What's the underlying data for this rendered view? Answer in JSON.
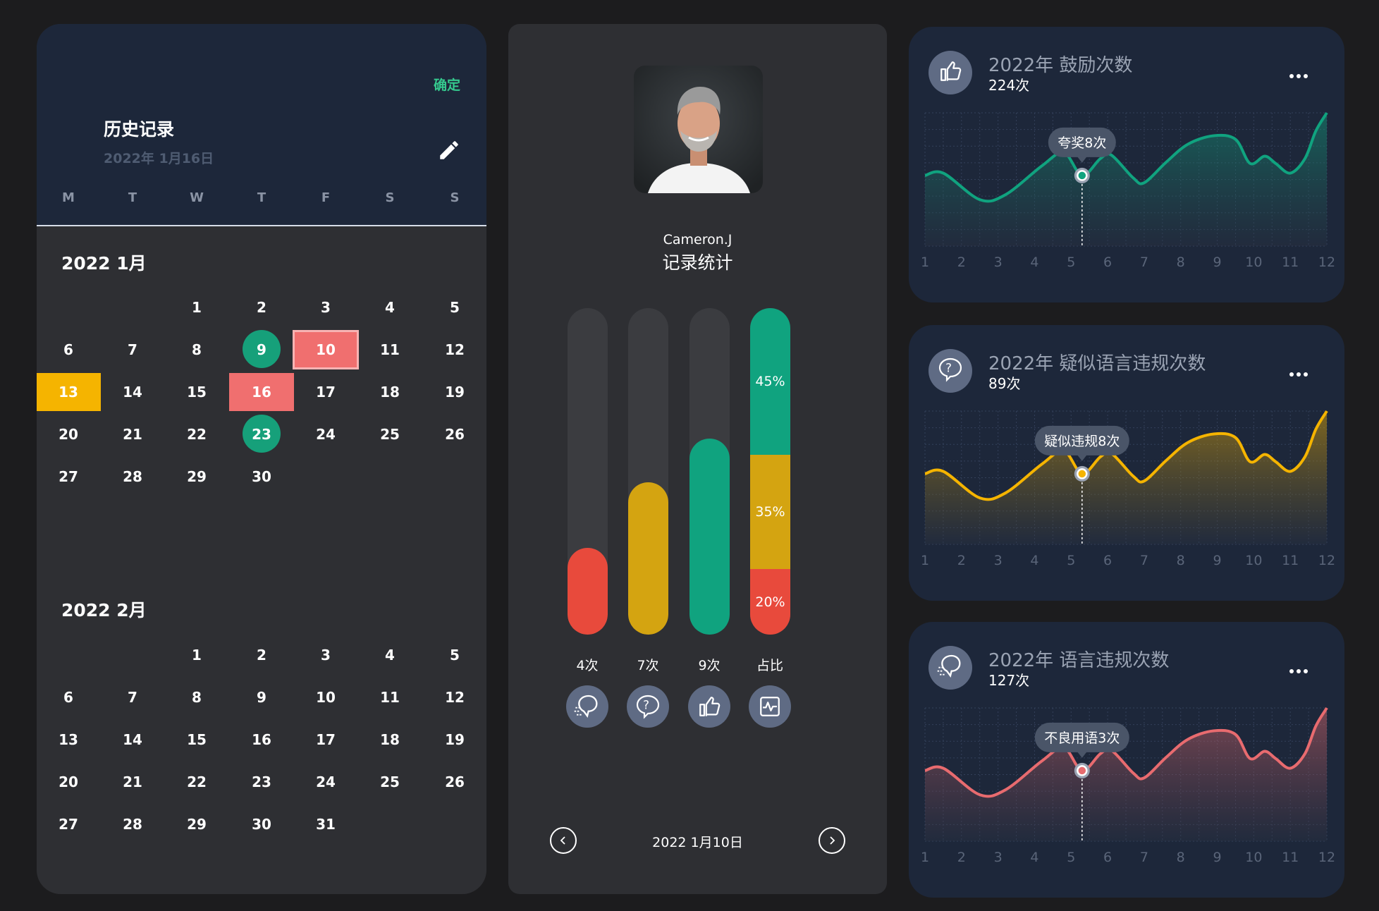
{
  "calendar": {
    "confirm": "确定",
    "title": "历史记录",
    "selected_date": "2022年 1月16日",
    "weekdays": [
      "M",
      "T",
      "W",
      "T",
      "F",
      "S",
      "S"
    ],
    "months": [
      {
        "label": "2022 1月",
        "start_col": 2,
        "days": 30,
        "marked": {
          "9": "circle",
          "23": "circle",
          "10": "red-outline",
          "16": "red",
          "13": "yellow"
        }
      },
      {
        "label": "2022 2月",
        "start_col": 2,
        "days": 31,
        "marked": {}
      }
    ]
  },
  "stats": {
    "user_name": "Cameron.J",
    "title": "记录统计",
    "bars": [
      {
        "label": "4次",
        "value": 4,
        "color": "#e84a3c",
        "icon": "speech-icon"
      },
      {
        "label": "7次",
        "value": 7,
        "color": "#d4a411",
        "icon": "question-icon"
      },
      {
        "label": "9次",
        "value": 9,
        "color": "#10a37f",
        "icon": "thumbs-up-icon"
      }
    ],
    "ratio": {
      "label": "占比",
      "icon": "pulse-icon",
      "segments": [
        {
          "pct": 20,
          "text": "20%",
          "color": "#e84a3c"
        },
        {
          "pct": 35,
          "text": "35%",
          "color": "#d4a411"
        },
        {
          "pct": 45,
          "text": "45%",
          "color": "#10a37f"
        }
      ]
    },
    "date": "2022 1月10日",
    "bar_max": 15
  },
  "cards": [
    {
      "title": "2022年 鼓励次数",
      "sub": "224次",
      "icon": "thumbs-up-icon",
      "color": "#10a37f",
      "tooltip": "夸奖8次"
    },
    {
      "title": "2022年 疑似语言违规次数",
      "sub": "89次",
      "icon": "question-icon",
      "color": "#f5b400",
      "tooltip": "疑似违规8次"
    },
    {
      "title": "2022年 语言违规次数",
      "sub": "127次",
      "icon": "speech-icon",
      "color": "#e86b6f",
      "tooltip": "不良用语3次"
    }
  ],
  "chart_data": {
    "type": "line",
    "x": [
      1,
      2,
      3,
      4,
      5,
      6,
      7,
      8,
      9,
      10,
      11,
      12
    ],
    "xlabel": "",
    "ylabel": "",
    "note_series_shape": "all three cards share the same smoothed curve shape",
    "series": [
      {
        "x": [
          1,
          1.5,
          2.5,
          3.2,
          4.2,
          4.8,
          5.3,
          5.8,
          6.1,
          6.7,
          7.0,
          7.6,
          8.2,
          8.9,
          9.5,
          9.9,
          10.3,
          10.6,
          11.0,
          11.4,
          11.7,
          12.0
        ],
        "y": [
          4.8,
          5.0,
          2.8,
          3.2,
          5.6,
          6.7,
          4.8,
          6.2,
          6.5,
          4.6,
          4.2,
          5.9,
          7.4,
          8.1,
          7.8,
          5.8,
          6.4,
          5.8,
          5.0,
          6.2,
          8.5,
          10.0
        ]
      }
    ],
    "highlight_x": 5.3,
    "ylim": [
      0,
      10
    ]
  }
}
